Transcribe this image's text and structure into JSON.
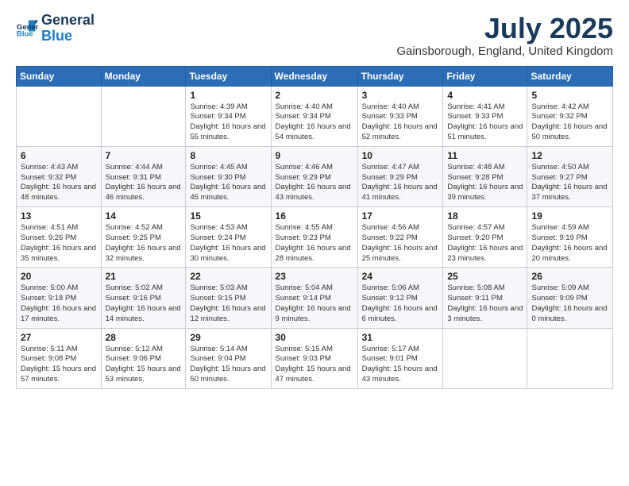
{
  "header": {
    "logo_line1": "General",
    "logo_line2": "Blue",
    "month": "July 2025",
    "location": "Gainsborough, England, United Kingdom"
  },
  "weekdays": [
    "Sunday",
    "Monday",
    "Tuesday",
    "Wednesday",
    "Thursday",
    "Friday",
    "Saturday"
  ],
  "weeks": [
    [
      {
        "day": "",
        "info": ""
      },
      {
        "day": "",
        "info": ""
      },
      {
        "day": "1",
        "info": "Sunrise: 4:39 AM\nSunset: 9:34 PM\nDaylight: 16 hours and 55 minutes."
      },
      {
        "day": "2",
        "info": "Sunrise: 4:40 AM\nSunset: 9:34 PM\nDaylight: 16 hours and 54 minutes."
      },
      {
        "day": "3",
        "info": "Sunrise: 4:40 AM\nSunset: 9:33 PM\nDaylight: 16 hours and 52 minutes."
      },
      {
        "day": "4",
        "info": "Sunrise: 4:41 AM\nSunset: 9:33 PM\nDaylight: 16 hours and 51 minutes."
      },
      {
        "day": "5",
        "info": "Sunrise: 4:42 AM\nSunset: 9:32 PM\nDaylight: 16 hours and 50 minutes."
      }
    ],
    [
      {
        "day": "6",
        "info": "Sunrise: 4:43 AM\nSunset: 9:32 PM\nDaylight: 16 hours and 48 minutes."
      },
      {
        "day": "7",
        "info": "Sunrise: 4:44 AM\nSunset: 9:31 PM\nDaylight: 16 hours and 46 minutes."
      },
      {
        "day": "8",
        "info": "Sunrise: 4:45 AM\nSunset: 9:30 PM\nDaylight: 16 hours and 45 minutes."
      },
      {
        "day": "9",
        "info": "Sunrise: 4:46 AM\nSunset: 9:29 PM\nDaylight: 16 hours and 43 minutes."
      },
      {
        "day": "10",
        "info": "Sunrise: 4:47 AM\nSunset: 9:29 PM\nDaylight: 16 hours and 41 minutes."
      },
      {
        "day": "11",
        "info": "Sunrise: 4:48 AM\nSunset: 9:28 PM\nDaylight: 16 hours and 39 minutes."
      },
      {
        "day": "12",
        "info": "Sunrise: 4:50 AM\nSunset: 9:27 PM\nDaylight: 16 hours and 37 minutes."
      }
    ],
    [
      {
        "day": "13",
        "info": "Sunrise: 4:51 AM\nSunset: 9:26 PM\nDaylight: 16 hours and 35 minutes."
      },
      {
        "day": "14",
        "info": "Sunrise: 4:52 AM\nSunset: 9:25 PM\nDaylight: 16 hours and 32 minutes."
      },
      {
        "day": "15",
        "info": "Sunrise: 4:53 AM\nSunset: 9:24 PM\nDaylight: 16 hours and 30 minutes."
      },
      {
        "day": "16",
        "info": "Sunrise: 4:55 AM\nSunset: 9:23 PM\nDaylight: 16 hours and 28 minutes."
      },
      {
        "day": "17",
        "info": "Sunrise: 4:56 AM\nSunset: 9:22 PM\nDaylight: 16 hours and 25 minutes."
      },
      {
        "day": "18",
        "info": "Sunrise: 4:57 AM\nSunset: 9:20 PM\nDaylight: 16 hours and 23 minutes."
      },
      {
        "day": "19",
        "info": "Sunrise: 4:59 AM\nSunset: 9:19 PM\nDaylight: 16 hours and 20 minutes."
      }
    ],
    [
      {
        "day": "20",
        "info": "Sunrise: 5:00 AM\nSunset: 9:18 PM\nDaylight: 16 hours and 17 minutes."
      },
      {
        "day": "21",
        "info": "Sunrise: 5:02 AM\nSunset: 9:16 PM\nDaylight: 16 hours and 14 minutes."
      },
      {
        "day": "22",
        "info": "Sunrise: 5:03 AM\nSunset: 9:15 PM\nDaylight: 16 hours and 12 minutes."
      },
      {
        "day": "23",
        "info": "Sunrise: 5:04 AM\nSunset: 9:14 PM\nDaylight: 16 hours and 9 minutes."
      },
      {
        "day": "24",
        "info": "Sunrise: 5:06 AM\nSunset: 9:12 PM\nDaylight: 16 hours and 6 minutes."
      },
      {
        "day": "25",
        "info": "Sunrise: 5:08 AM\nSunset: 9:11 PM\nDaylight: 16 hours and 3 minutes."
      },
      {
        "day": "26",
        "info": "Sunrise: 5:09 AM\nSunset: 9:09 PM\nDaylight: 16 hours and 0 minutes."
      }
    ],
    [
      {
        "day": "27",
        "info": "Sunrise: 5:11 AM\nSunset: 9:08 PM\nDaylight: 15 hours and 57 minutes."
      },
      {
        "day": "28",
        "info": "Sunrise: 5:12 AM\nSunset: 9:06 PM\nDaylight: 15 hours and 53 minutes."
      },
      {
        "day": "29",
        "info": "Sunrise: 5:14 AM\nSunset: 9:04 PM\nDaylight: 15 hours and 50 minutes."
      },
      {
        "day": "30",
        "info": "Sunrise: 5:15 AM\nSunset: 9:03 PM\nDaylight: 15 hours and 47 minutes."
      },
      {
        "day": "31",
        "info": "Sunrise: 5:17 AM\nSunset: 9:01 PM\nDaylight: 15 hours and 43 minutes."
      },
      {
        "day": "",
        "info": ""
      },
      {
        "day": "",
        "info": ""
      }
    ]
  ]
}
